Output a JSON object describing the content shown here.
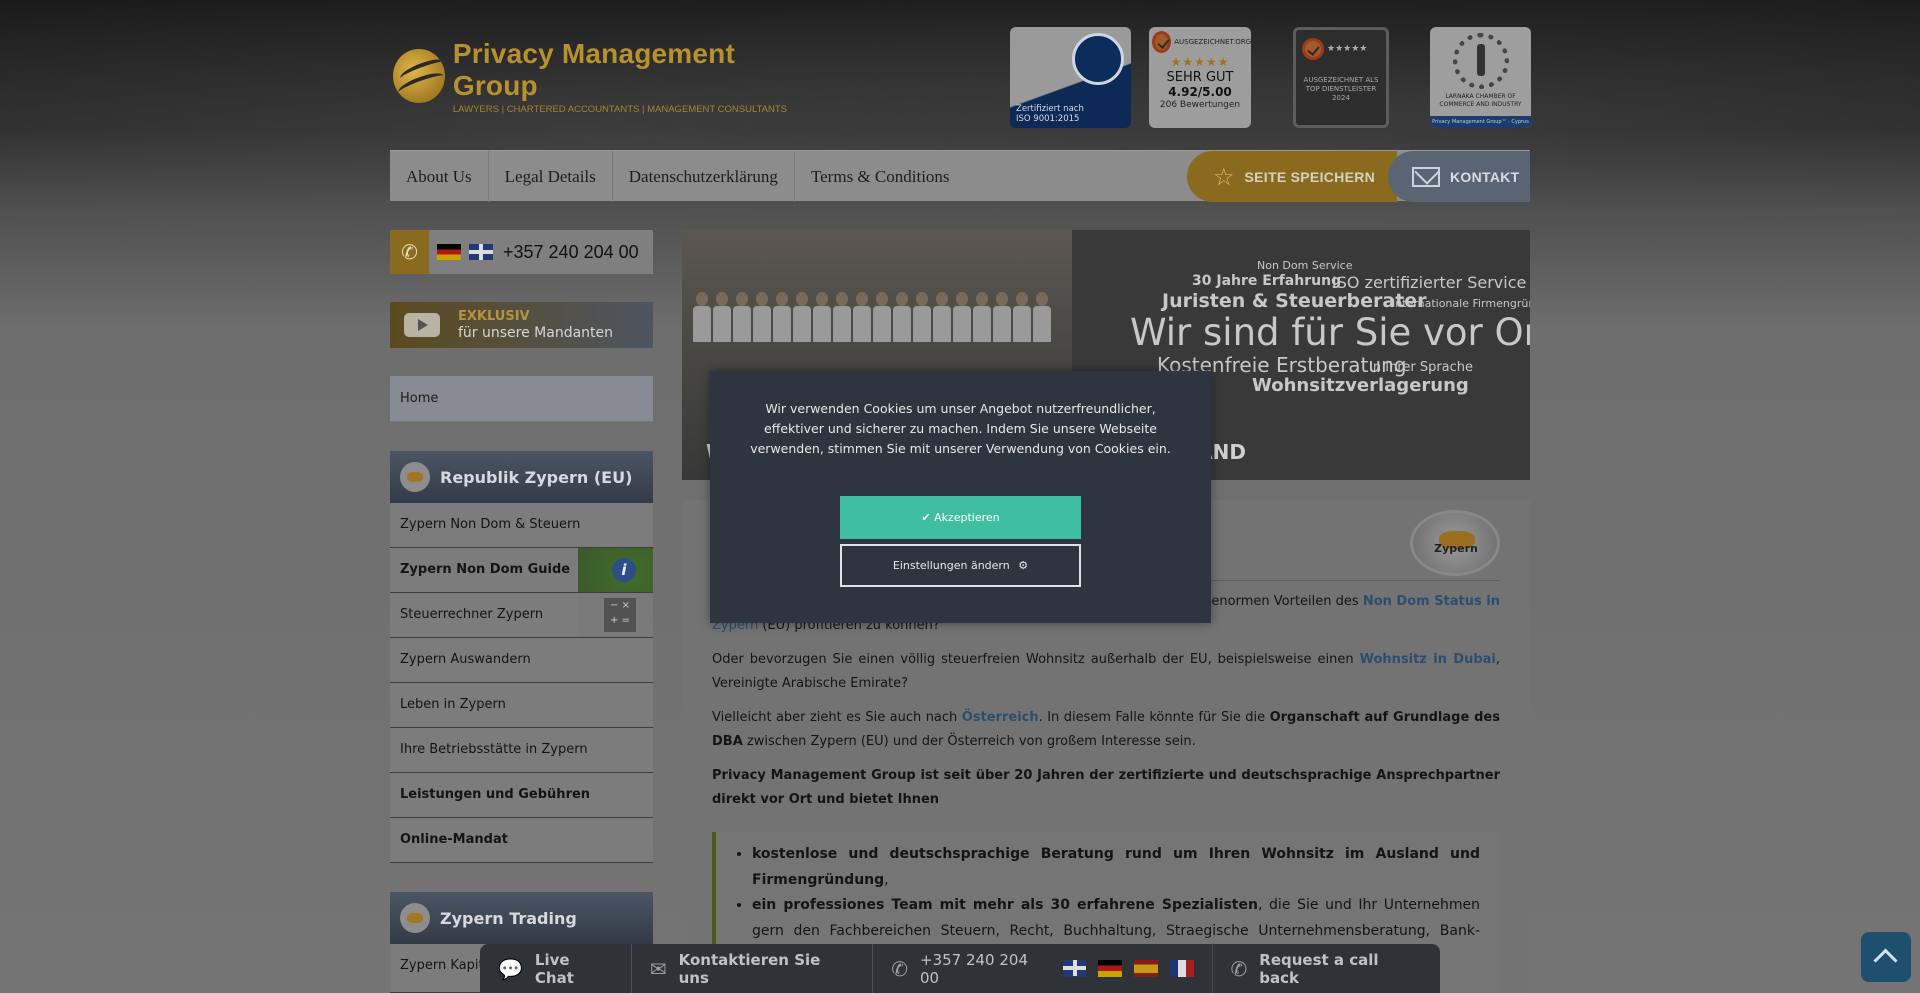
{
  "header": {
    "logo_title": "Privacy Management Group",
    "logo_subtitle": "LAWYERS | CHARTERED ACCOUNTANTS | MANAGEMENT CONSULTANTS",
    "badges": {
      "tuv_caption": "Zertifiziert nach ISO 9001:2015",
      "aus_top": "AUSGEZEICHNET.ORG",
      "aus_rating_text": "SEHR GUT",
      "aus_score": "4.92/5.00",
      "aus_reviews": "206 Bewertungen",
      "top_text": "AUSGEZEICHNET ALS TOP DIENSTLEISTER 2024",
      "larnaca_text": "LARNAKA CHAMBER OF COMMERCE AND INDUSTRY",
      "larnaca_strip": "Privacy Management Group™ · Cyprus"
    }
  },
  "nav": {
    "items": [
      "About Us",
      "Legal Details",
      "Datenschutzerklärung",
      "Terms & Conditions"
    ],
    "save_label": "SEITE SPEICHERN",
    "contact_label": "KONTAKT"
  },
  "sidebar": {
    "phone": "+357 240 204 00",
    "exklusiv_t1": "EXKLUSIV",
    "exklusiv_t2": "für unsere Mandanten",
    "home": "Home",
    "section1": "Republik Zypern (EU)",
    "items": [
      "Zypern Non Dom & Steuern",
      "Zypern Non Dom Guide",
      "Steuerrechner Zypern",
      "Zypern Auswandern",
      "Leben in Zypern",
      "Ihre Betriebsstätte in Zypern",
      "Leistungen und Gebühren",
      "Online-Mandat"
    ],
    "section2": "Zypern Trading",
    "section2_item": "Zypern Kapita"
  },
  "hero": {
    "l1": "Non Dom Service",
    "l2a": "30 Jahre Erfahrung",
    "l2b": "ISO zertifizierter Service",
    "l3a": "Juristen & Steuerberater",
    "l3b": "Internationale Firmengründung",
    "l4": "Wir sind für Sie vor Ort",
    "l5a": "Kostenfreie Erstberatung",
    "l5b": "In Ihrer Sprache",
    "l6": "Wohnsitzverlagerung",
    "l7a": "W",
    "l7b": "M AUSLAND"
  },
  "content": {
    "badge_label": "Zypern",
    "p1_pre": "en enormen Vorteilen des",
    "p1_link": "Non Dom Status in",
    "p1_link2": "Zypern",
    "p1_post": "(EU) profitieren zu können?",
    "p2_pre": "Oder bevorzugen Sie einen völlig steuerfreien Wohnsitz außerhalb der EU, beispielsweise einen",
    "p2_link": "Wohnsitz in Dubai",
    "p2_post": ", Vereinigte Arabische Emirate?",
    "p3_pre": "Vielleicht aber zieht es Sie auch nach",
    "p3_link": "Österreich",
    "p3_mid": ". In diesem Falle könnte für Sie die",
    "p3_bold": "Organschaft auf Grundlage des DBA",
    "p3_post": "zwischen Zypern (EU) und der Österreich von großem Interesse sein.",
    "p4": "Privacy Management Group ist seit über 20 Jahren der zertifizierte und deutschsprachige Ansprechpartner direkt vor Ort und bietet Ihnen",
    "li1_bold": "kostenlose und deutschsprachige Beratung rund um Ihren Wohnsitz im Ausland und Firmengründung",
    "li1_post": ",",
    "li2_bold": "ein professiones Team mit mehr als 30 erfahrene Spezialisten",
    "li2_post": ", die Sie und Ihr Unternehmen gern den Fachbereichen Steuern, Recht, Buchhaltung, Straegische Unternehmensberatung, Bank-Account-Service und Asset Protection umfassend beraten,"
  },
  "cookie": {
    "text": "Wir verwenden Cookies um unser Angebot nutzerfreundlicher, effektiver und sicherer zu machen. Indem Sie unsere Webseite verwenden, stimmen Sie mit unserer Verwendung von Cookies ein.",
    "accept": "Akzeptieren",
    "settings": "Einstellungen ändern"
  },
  "bottom_bar": {
    "chat": "Live Chat",
    "contact": "Kontaktieren Sie uns",
    "phone": "+357 240 204 00",
    "callback": "Request a call back"
  },
  "colors": {
    "accent_gold": "#8a6a1e",
    "accept_green": "#3fbfa0",
    "link_blue": "#2d4d6e",
    "dark_panel": "#2f353f"
  }
}
